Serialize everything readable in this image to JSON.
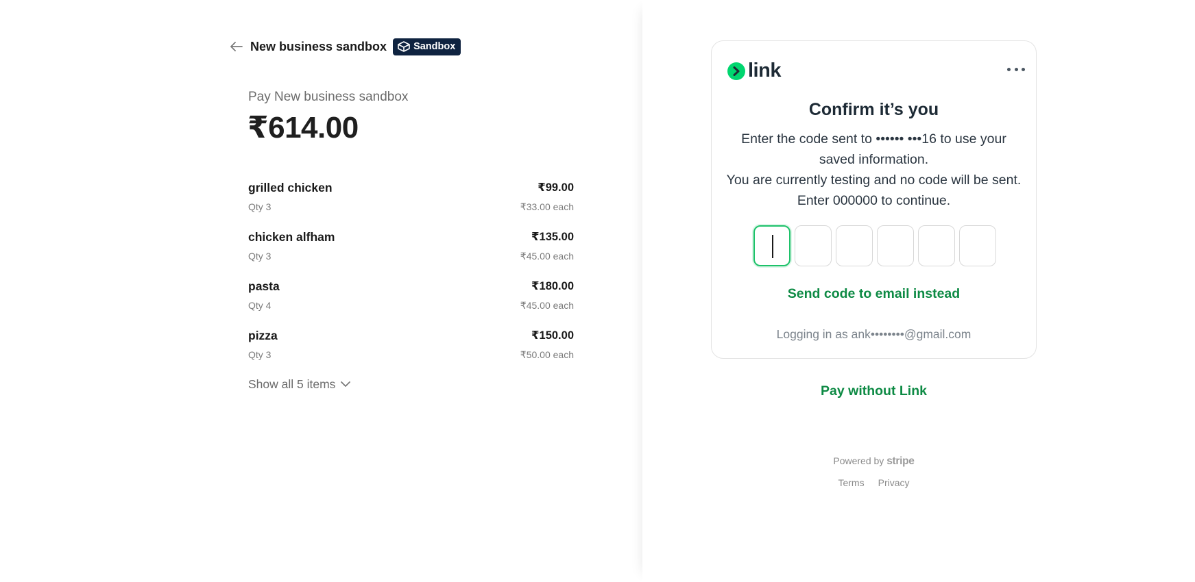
{
  "header": {
    "merchant_name": "New business sandbox",
    "badge_label": "Sandbox"
  },
  "summary": {
    "pay_label": "Pay New business sandbox",
    "total": "₹614.00"
  },
  "items": [
    {
      "name": "grilled chicken",
      "qty": "Qty 3",
      "total": "₹99.00",
      "each": "₹33.00 each"
    },
    {
      "name": "chicken alfham",
      "qty": "Qty 3",
      "total": "₹135.00",
      "each": "₹45.00 each"
    },
    {
      "name": "pasta",
      "qty": "Qty 4",
      "total": "₹180.00",
      "each": "₹45.00 each"
    },
    {
      "name": "pizza",
      "qty": "Qty 3",
      "total": "₹150.00",
      "each": "₹50.00 each"
    }
  ],
  "show_all_label": "Show all 5 items",
  "link_card": {
    "logo_text": "link",
    "title": "Confirm it’s you",
    "description_line1": "Enter the code sent to •••••• •••16 to use your saved information.",
    "description_line2": "You are currently testing and no code will be sent. Enter 000000 to continue.",
    "code_boxes": [
      "",
      "",
      "",
      "",
      "",
      ""
    ],
    "send_email_label": "Send code to email instead",
    "logging_in": "Logging in as ank••••••••@gmail.com"
  },
  "pay_without_link": "Pay without Link",
  "footer": {
    "powered_by": "Powered by",
    "brand": "stripe",
    "terms": "Terms",
    "privacy": "Privacy"
  },
  "colors": {
    "badge_bg": "#0f2340",
    "link_green": "#00d66f",
    "action_green": "#0d8a44",
    "active_border": "#1ec26a"
  }
}
